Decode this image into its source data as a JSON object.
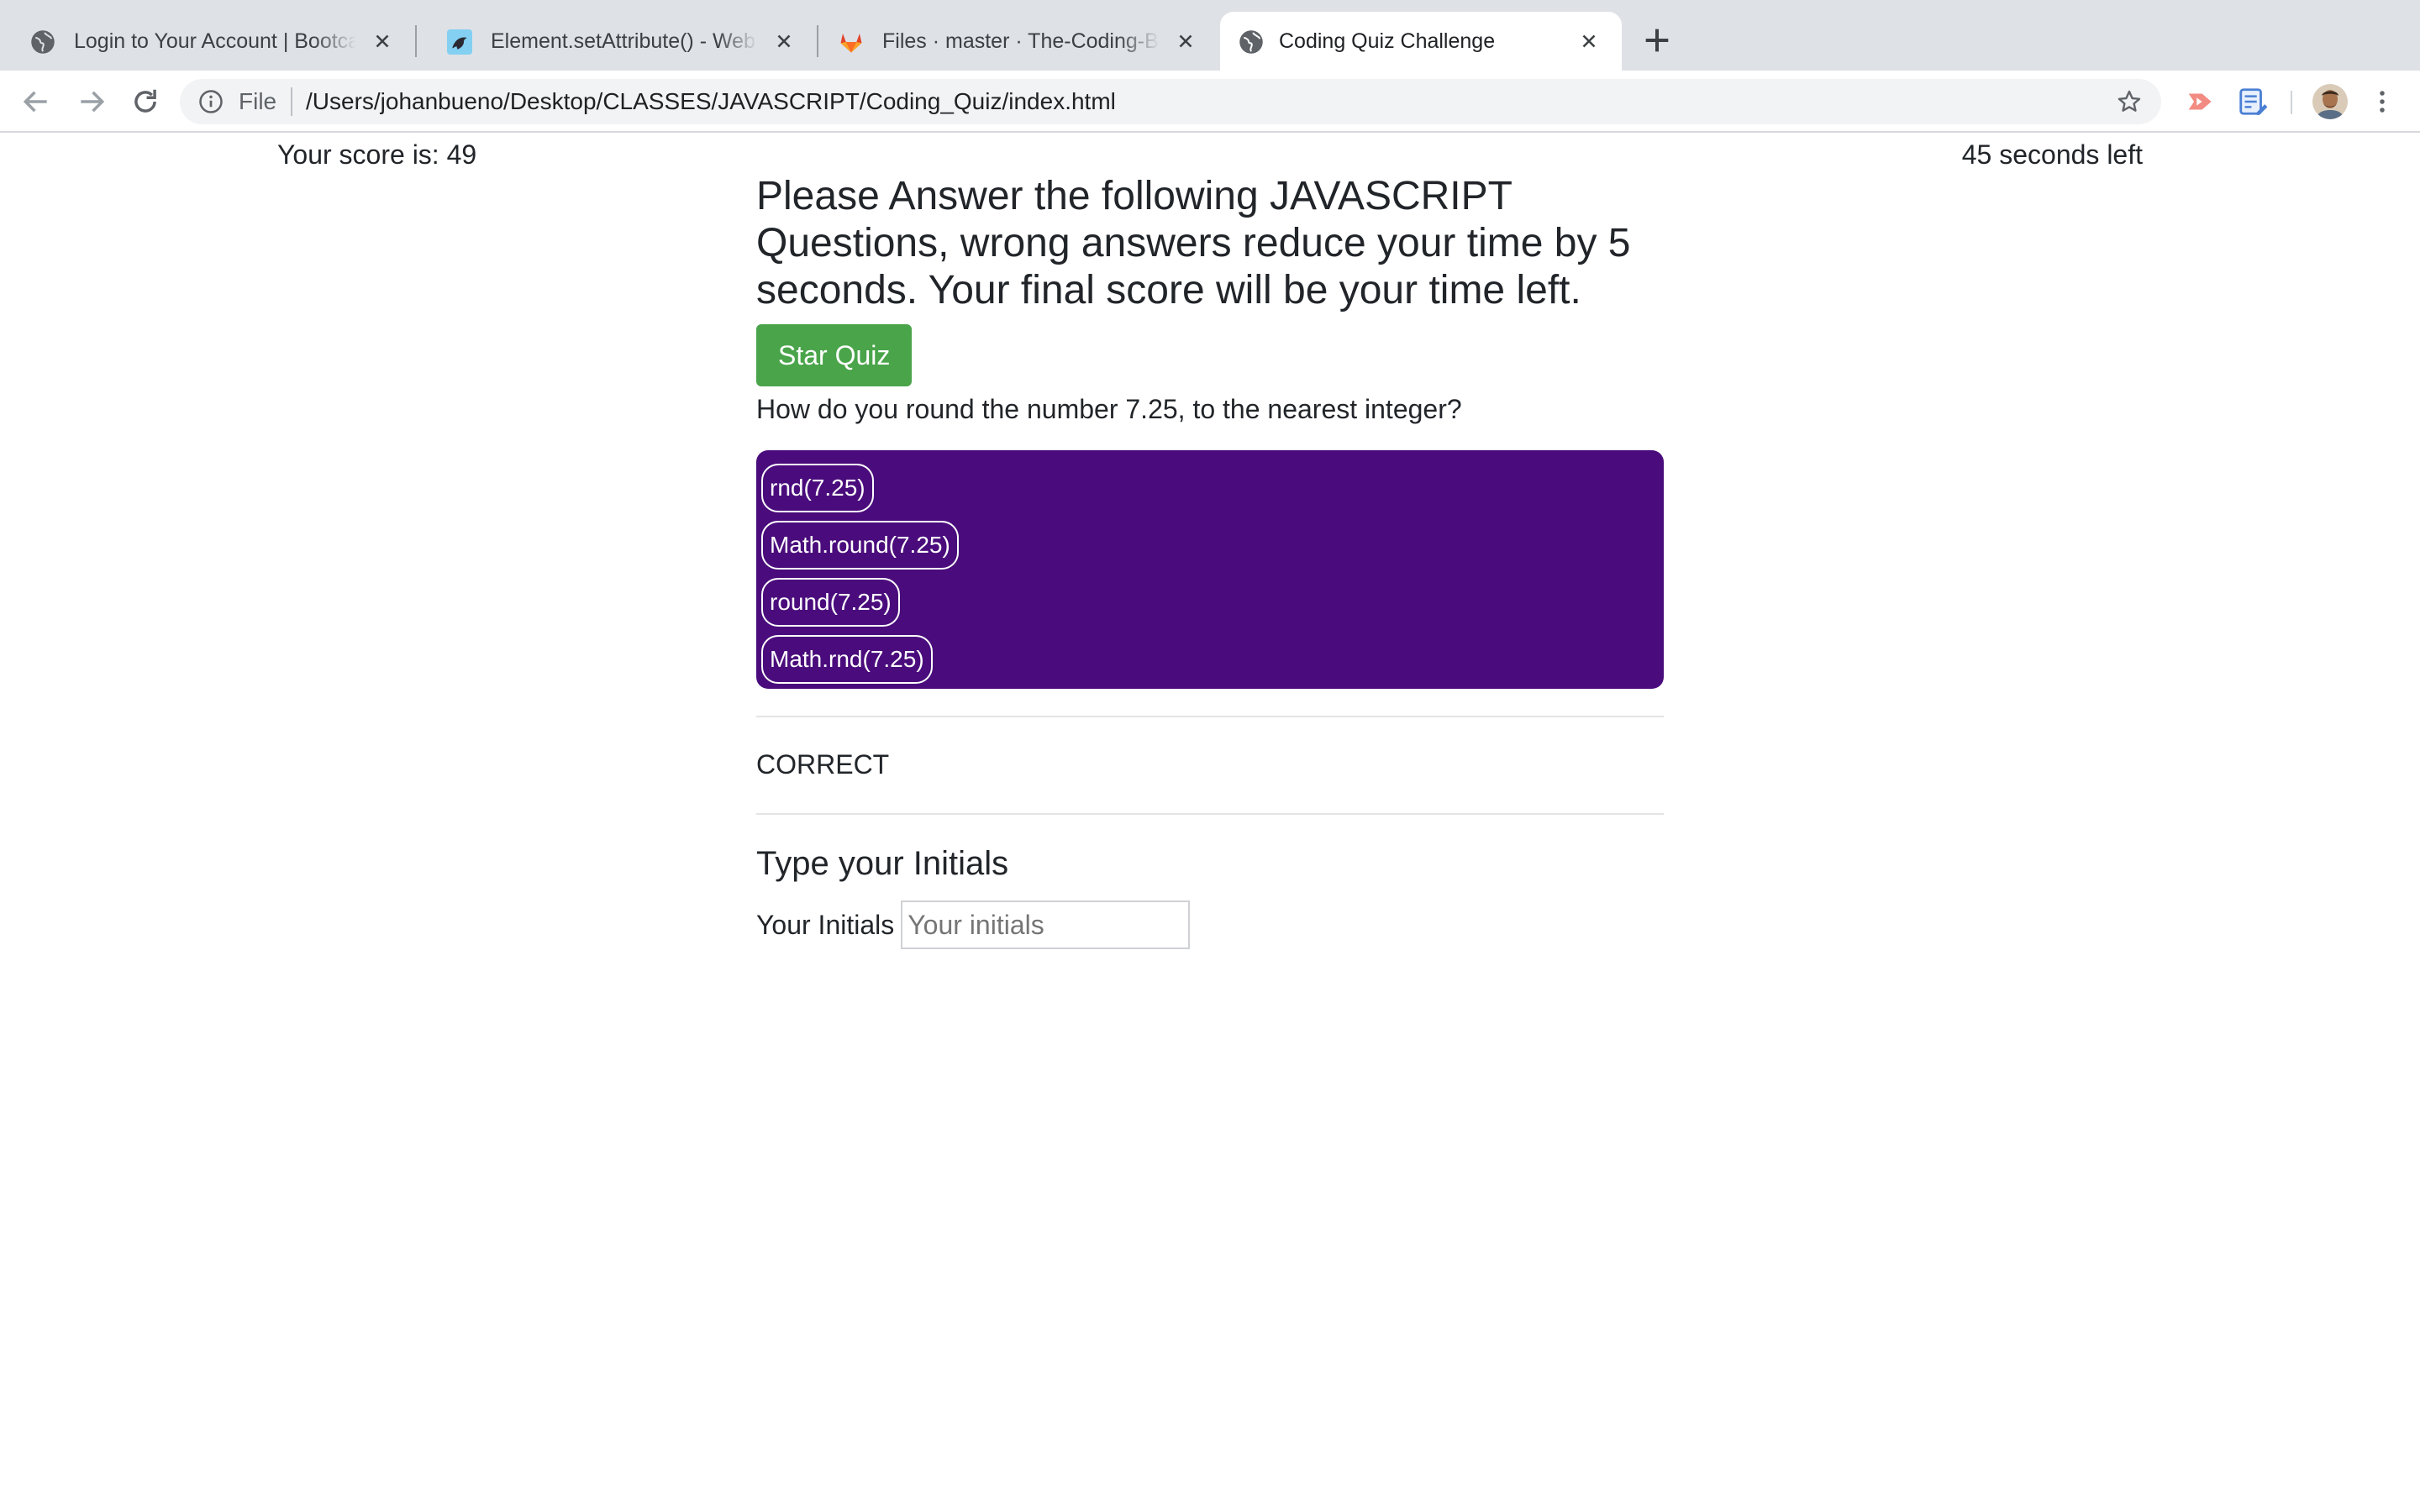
{
  "browser": {
    "tabs": [
      {
        "title": "Login to Your Account | Bootcamp Spot",
        "favicon": "globe-icon",
        "active": false
      },
      {
        "title": "Element.setAttribute() - Web APIs | MDN",
        "favicon": "mdn-icon",
        "active": false
      },
      {
        "title": "Files · master · The-Coding-Boot-Camp",
        "favicon": "gitlab-icon",
        "active": false
      },
      {
        "title": "Coding Quiz Challenge",
        "favicon": "globe-icon",
        "active": true
      }
    ],
    "address_bar": {
      "scheme_label": "File",
      "url": "/Users/johanbueno/Desktop/CLASSES/JAVASCRIPT/Coding_Quiz/index.html"
    },
    "extensions": [
      "cast-icon",
      "notes-extension-icon"
    ]
  },
  "page": {
    "score_text": "Your score is: 49",
    "timer_text": "45 seconds left",
    "headline": "Please Answer the following JAVASCRIPT Questions, wrong answers reduce your time by 5 seconds. Your final score will be your time left.",
    "start_button": "Star Quiz",
    "question": "How do you round the number 7.25, to the nearest integer?",
    "answers": [
      "rnd(7.25)",
      "Math.round(7.25)",
      "round(7.25)",
      "Math.rnd(7.25)"
    ],
    "result": "CORRECT",
    "initials_title": "Type your Initials",
    "initials_label": "Your Initials",
    "initials_placeholder": "Your initials",
    "initials_value": ""
  },
  "colors": {
    "tabstrip_bg": "#dee1e6",
    "start_button": "#4aa44a",
    "answers_panel": "#4a0c7c",
    "text": "#212529"
  }
}
